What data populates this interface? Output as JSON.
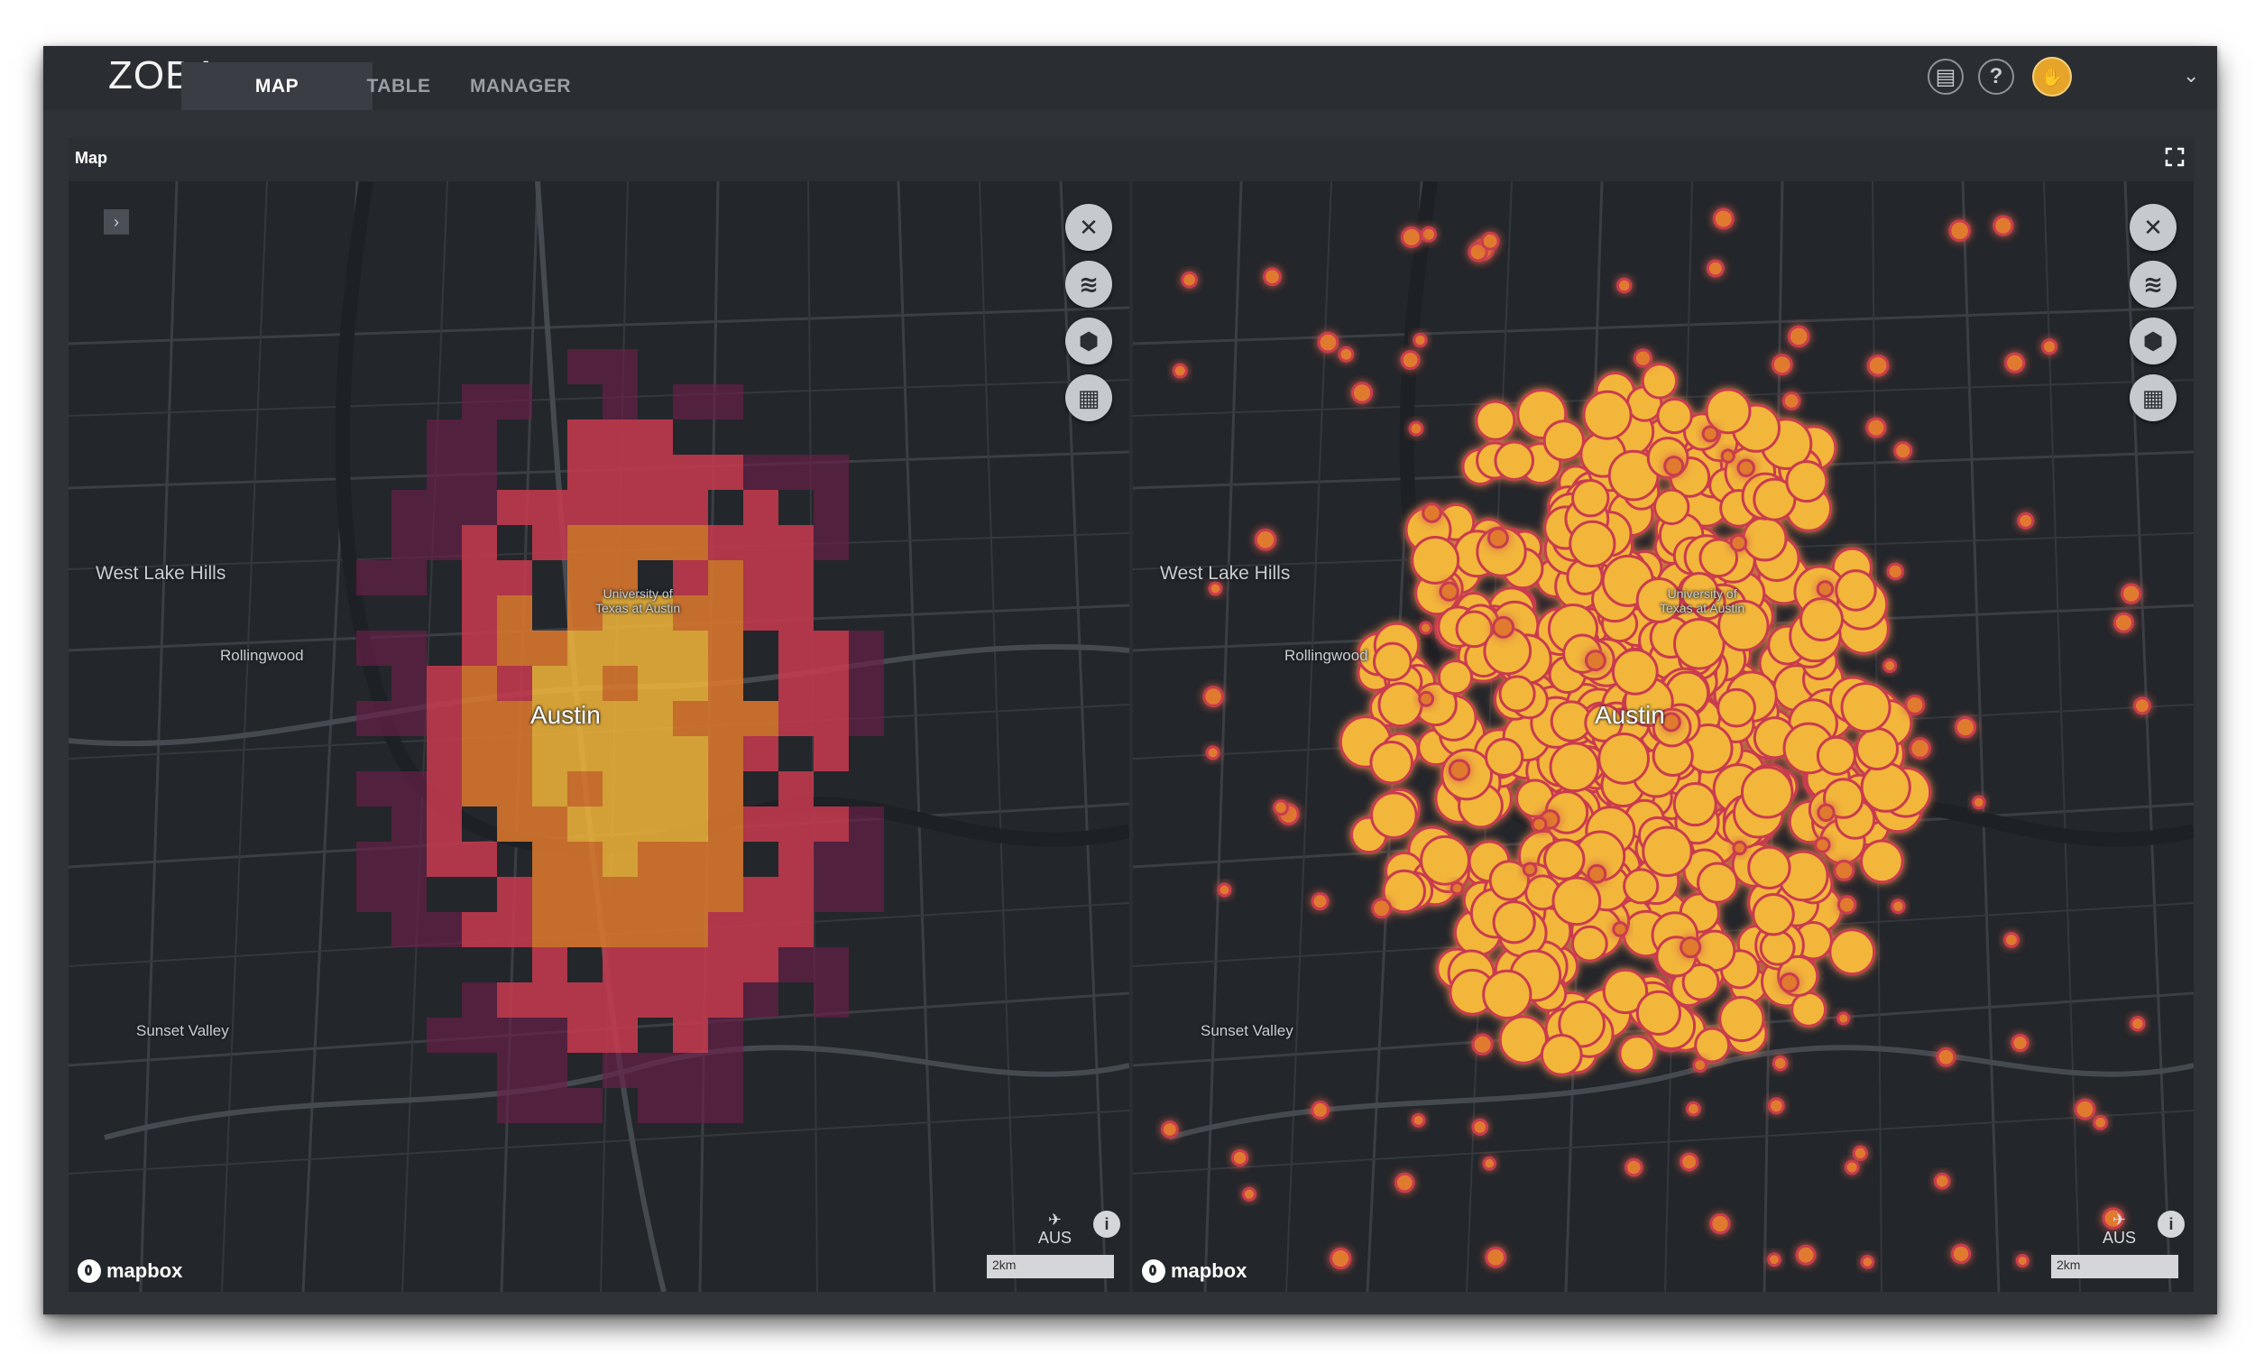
{
  "app": {
    "logo": "ZOBA"
  },
  "tabs": [
    {
      "label": "MAP",
      "active": true
    },
    {
      "label": "TABLE",
      "active": false
    },
    {
      "label": "MANAGER",
      "active": false
    }
  ],
  "header_icons": [
    {
      "name": "notes-icon",
      "glyph": "▤"
    },
    {
      "name": "help-icon",
      "glyph": "?"
    }
  ],
  "panel": {
    "title": "Map"
  },
  "map_labels": {
    "west_lake_hills": "West Lake Hills",
    "rollingwood": "Rollingwood",
    "austin": "Austin",
    "university_line1": "University of",
    "university_line2": "Texas at Austin",
    "sunset_valley": "Sunset Valley",
    "airport": "AUS",
    "scale": "2km",
    "attribution": "mapbox"
  },
  "map_controls": [
    {
      "name": "close-map-icon",
      "glyph": "✕"
    },
    {
      "name": "layers-icon",
      "glyph": "≋"
    },
    {
      "name": "shield-icon",
      "glyph": "⬢"
    },
    {
      "name": "table-icon",
      "glyph": "▦"
    }
  ],
  "colors": {
    "heat_low": "#6a1f4a",
    "heat_mid": "#c93a4f",
    "heat_high": "#e07a2e",
    "heat_max": "#f2b63a"
  }
}
